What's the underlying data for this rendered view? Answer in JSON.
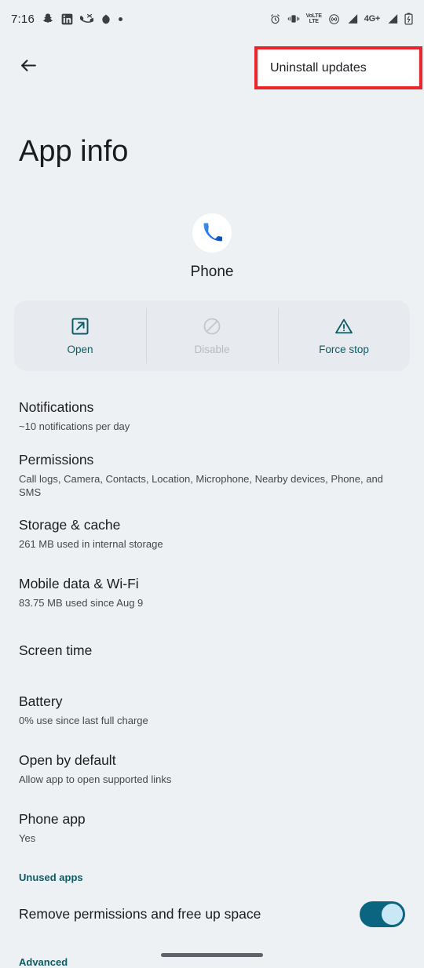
{
  "statusbar": {
    "time": "7:16",
    "left_icons": [
      "snapchat-icon",
      "linkedin-icon",
      "missed-call-icon",
      "app-icon",
      "dot-indicator"
    ],
    "volte_label_top": "VoLTE",
    "volte_label_bottom": "LTE",
    "network_label": "4G+",
    "right_icons": [
      "alarm-icon",
      "vibrate-icon",
      "volte-icon",
      "hotspot-icon",
      "signal-icon",
      "signal-icon-2",
      "battery-icon"
    ]
  },
  "appbar": {
    "back_icon": "back-arrow-icon",
    "overflow_menu": {
      "items": [
        "Uninstall updates"
      ],
      "highlight_color": "#e8262b"
    }
  },
  "page": {
    "title": "App info",
    "accent_color": "#0c5c66",
    "background_color": "#eef1f4"
  },
  "app": {
    "name": "Phone",
    "icon": "phone-handset-icon"
  },
  "actions": [
    {
      "label": "Open",
      "icon": "external-link-icon",
      "disabled": false
    },
    {
      "label": "Disable",
      "icon": "block-circle-icon",
      "disabled": true
    },
    {
      "label": "Force stop",
      "icon": "warning-triangle-icon",
      "disabled": false
    }
  ],
  "settings": [
    {
      "title": "Notifications",
      "subtitle": "~10 notifications per day"
    },
    {
      "title": "Permissions",
      "subtitle": "Call logs, Camera, Contacts, Location, Microphone, Nearby devices, Phone, and SMS"
    },
    {
      "title": "Storage & cache",
      "subtitle": "261 MB used in internal storage"
    },
    {
      "title": "Mobile data & Wi-Fi",
      "subtitle": "83.75 MB used since Aug 9"
    },
    {
      "title": "Screen time",
      "subtitle": ""
    },
    {
      "title": "Battery",
      "subtitle": "0% use since last full charge"
    },
    {
      "title": "Open by default",
      "subtitle": "Allow app to open supported links"
    },
    {
      "title": "Phone app",
      "subtitle": "Yes"
    }
  ],
  "unused_apps": {
    "header": "Unused apps",
    "toggle_label": "Remove permissions and free up space",
    "toggle_on": true
  },
  "advanced": {
    "label": "Advanced"
  }
}
